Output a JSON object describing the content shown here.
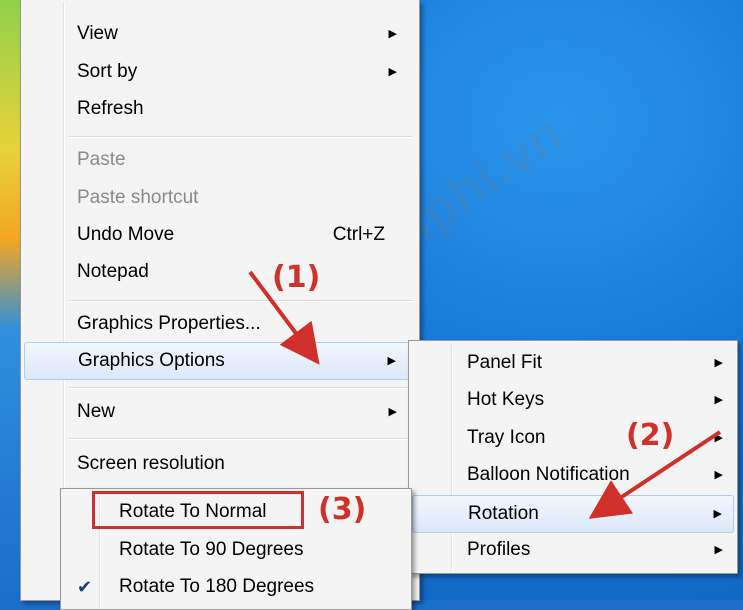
{
  "main_menu": {
    "items": [
      {
        "label": "View",
        "submenu": true
      },
      {
        "label": "Sort by",
        "submenu": true
      },
      {
        "label": "Refresh"
      },
      {
        "label": "Paste",
        "disabled": true
      },
      {
        "label": "Paste shortcut",
        "disabled": true
      },
      {
        "label": "Undo Move",
        "shortcut": "Ctrl+Z"
      },
      {
        "label": "Notepad"
      },
      {
        "label": "Graphics Properties..."
      },
      {
        "label": "Graphics Options",
        "submenu": true,
        "highlighted": true
      },
      {
        "label": "New",
        "submenu": true
      },
      {
        "label": "Screen resolution"
      }
    ]
  },
  "graphics_options_menu": {
    "items": [
      {
        "label": "Panel Fit",
        "submenu": true
      },
      {
        "label": "Hot Keys",
        "submenu": true
      },
      {
        "label": "Tray Icon",
        "submenu": true
      },
      {
        "label": "Balloon Notification",
        "submenu": true
      },
      {
        "label": "Rotation",
        "submenu": true,
        "highlighted": true
      },
      {
        "label": "Profiles",
        "submenu": true
      }
    ]
  },
  "rotation_menu": {
    "items": [
      {
        "label": "Rotate To Normal",
        "boxed": true
      },
      {
        "label": "Rotate To 90 Degrees"
      },
      {
        "label": "Rotate To 180 Degrees",
        "checked": true
      }
    ]
  },
  "annotations": {
    "step1": "(1)",
    "step2": "(2)",
    "step3": "(3)",
    "accent_color": "#d0302a"
  },
  "icons": {
    "submenu_arrow": "triangle-right",
    "check": "checkmark"
  }
}
